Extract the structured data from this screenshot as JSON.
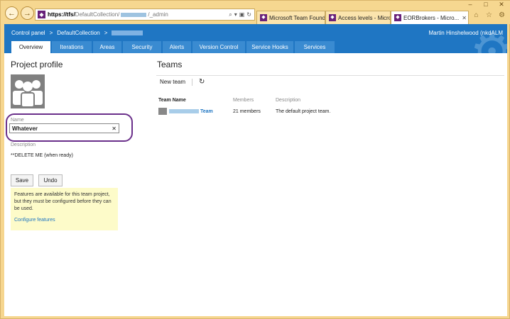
{
  "browser": {
    "url_host": "https://tfs/",
    "url_path": "DefaultCollection/",
    "url_suffix": "/_admin",
    "tabs": [
      {
        "title": "Microsoft Team Found...",
        "active": false
      },
      {
        "title": "Access levels - Microso...",
        "active": false
      },
      {
        "title": "EORBrokers - Micro...",
        "active": true
      }
    ]
  },
  "header": {
    "breadcrumb": [
      "Control panel",
      ">",
      "DefaultCollection",
      ">"
    ],
    "user": "Martin Hinshelwood (nkdALM",
    "nav": [
      {
        "label": "Overview",
        "active": true,
        "width": 55
      },
      {
        "label": "Iterations",
        "active": false,
        "width": 56
      },
      {
        "label": "Areas",
        "active": false,
        "width": 40
      },
      {
        "label": "Security",
        "active": false,
        "width": 54
      },
      {
        "label": "Alerts",
        "active": false,
        "width": 40
      },
      {
        "label": "Version Control",
        "active": false,
        "width": 74
      },
      {
        "label": "Service Hooks",
        "active": false,
        "width": 66
      },
      {
        "label": "Services",
        "active": false,
        "width": 56
      }
    ]
  },
  "profile": {
    "title": "Project profile",
    "name_label": "Name",
    "name_value": "Whatever",
    "description_label": "Description",
    "description_value": "**DELETE ME (when ready)",
    "save_label": "Save",
    "undo_label": "Undo",
    "note_text": "Features are available for this team project, but they must be configured before they can be used.",
    "configure_link": "Configure features"
  },
  "teams": {
    "title": "Teams",
    "new_team_label": "New team",
    "columns": [
      "Team Name",
      "Members",
      "Description"
    ],
    "rows": [
      {
        "name": "Team",
        "members": "21 members",
        "description": "The default project team."
      }
    ]
  }
}
